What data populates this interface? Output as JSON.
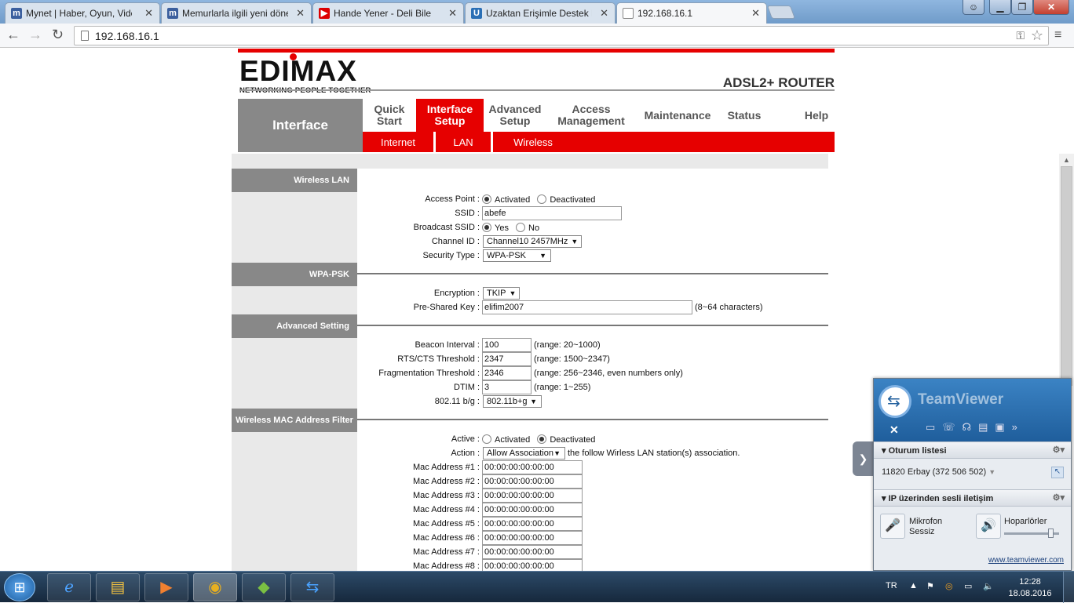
{
  "browser": {
    "tabs": [
      {
        "label": "Mynet | Haber, Oyun, Vide",
        "icon": "mynet-icon"
      },
      {
        "label": "Memurlarla ilgili yeni döne",
        "icon": "mynet-icon"
      },
      {
        "label": "Hande Yener - Deli Bile",
        "icon": "youtube-icon"
      },
      {
        "label": "Uzaktan Erişimle Destek H",
        "icon": "site-icon"
      },
      {
        "label": "192.168.16.1",
        "icon": "page-icon"
      }
    ],
    "close_glyph": "✕",
    "url": "192.168.16.1"
  },
  "router": {
    "brand": "EDIMAX",
    "tagline": "NETWORKING PEOPLE TOGETHER",
    "model": "ADSL2+ ROUTER",
    "section": "Interface",
    "nav": [
      {
        "label": "Quick Start"
      },
      {
        "label": "Interface Setup",
        "active": true
      },
      {
        "label": "Advanced Setup"
      },
      {
        "label": "Access Management"
      },
      {
        "label": "Maintenance"
      },
      {
        "label": "Status"
      },
      {
        "label": "Help"
      }
    ],
    "subnav": [
      "Internet",
      "LAN",
      "Wireless"
    ]
  },
  "form": {
    "wireless_lan": {
      "heading": "Wireless LAN",
      "access_point_label": "Access Point :",
      "activated": "Activated",
      "deactivated": "Deactivated",
      "ssid_label": "SSID :",
      "ssid_value": "abefe",
      "broadcast_label": "Broadcast SSID :",
      "yes": "Yes",
      "no": "No",
      "channel_label": "Channel ID :",
      "channel_value": "Channel10 2457MHz",
      "security_label": "Security Type :",
      "security_value": "WPA-PSK"
    },
    "wpa_psk": {
      "heading": "WPA-PSK",
      "encryption_label": "Encryption :",
      "encryption_value": "TKIP",
      "psk_label": "Pre-Shared Key :",
      "psk_value": "elifim2007",
      "psk_hint": "(8~64 characters)"
    },
    "advanced": {
      "heading": "Advanced Setting",
      "beacon_label": "Beacon Interval :",
      "beacon_value": "100",
      "beacon_hint": "(range: 20~1000)",
      "rts_label": "RTS/CTS Threshold :",
      "rts_value": "2347",
      "rts_hint": "(range: 1500~2347)",
      "frag_label": "Fragmentation Threshold :",
      "frag_value": "2346",
      "frag_hint": "(range: 256~2346, even numbers only)",
      "dtim_label": "DTIM :",
      "dtim_value": "3",
      "dtim_hint": "(range: 1~255)",
      "mode_label": "802.11 b/g :",
      "mode_value": "802.11b+g"
    },
    "mac_filter": {
      "heading": "Wireless MAC Address Filter",
      "active_label": "Active :",
      "activated": "Activated",
      "deactivated": "Deactivated",
      "action_label": "Action :",
      "action_value": "Allow Association",
      "action_hint": "the follow Wirless LAN station(s) association.",
      "macs": [
        {
          "label": "Mac Address #1 :",
          "value": "00:00:00:00:00:00"
        },
        {
          "label": "Mac Address #2 :",
          "value": "00:00:00:00:00:00"
        },
        {
          "label": "Mac Address #3 :",
          "value": "00:00:00:00:00:00"
        },
        {
          "label": "Mac Address #4 :",
          "value": "00:00:00:00:00:00"
        },
        {
          "label": "Mac Address #5 :",
          "value": "00:00:00:00:00:00"
        },
        {
          "label": "Mac Address #6 :",
          "value": "00:00:00:00:00:00"
        },
        {
          "label": "Mac Address #7 :",
          "value": "00:00:00:00:00:00"
        },
        {
          "label": "Mac Address #8 :",
          "value": "00:00:00:00:00:00"
        }
      ]
    }
  },
  "teamviewer": {
    "title": "TeamViewer",
    "session_heading": "Oturum listesi",
    "session_entry": "11820 Erbay (372 506 502)",
    "voip_heading": "IP üzerinden sesli iletişim",
    "mic_label": "Mikrofon",
    "mic_state": "Sessiz",
    "speaker_label": "Hoparlörler",
    "speaker_volume": 0.85,
    "link": "www.teamviewer.com"
  },
  "taskbar": {
    "language": "TR",
    "time": "12:28",
    "date": "18.08.2016"
  },
  "colors": {
    "router_red": "#e60000",
    "section_gray": "#888888"
  }
}
